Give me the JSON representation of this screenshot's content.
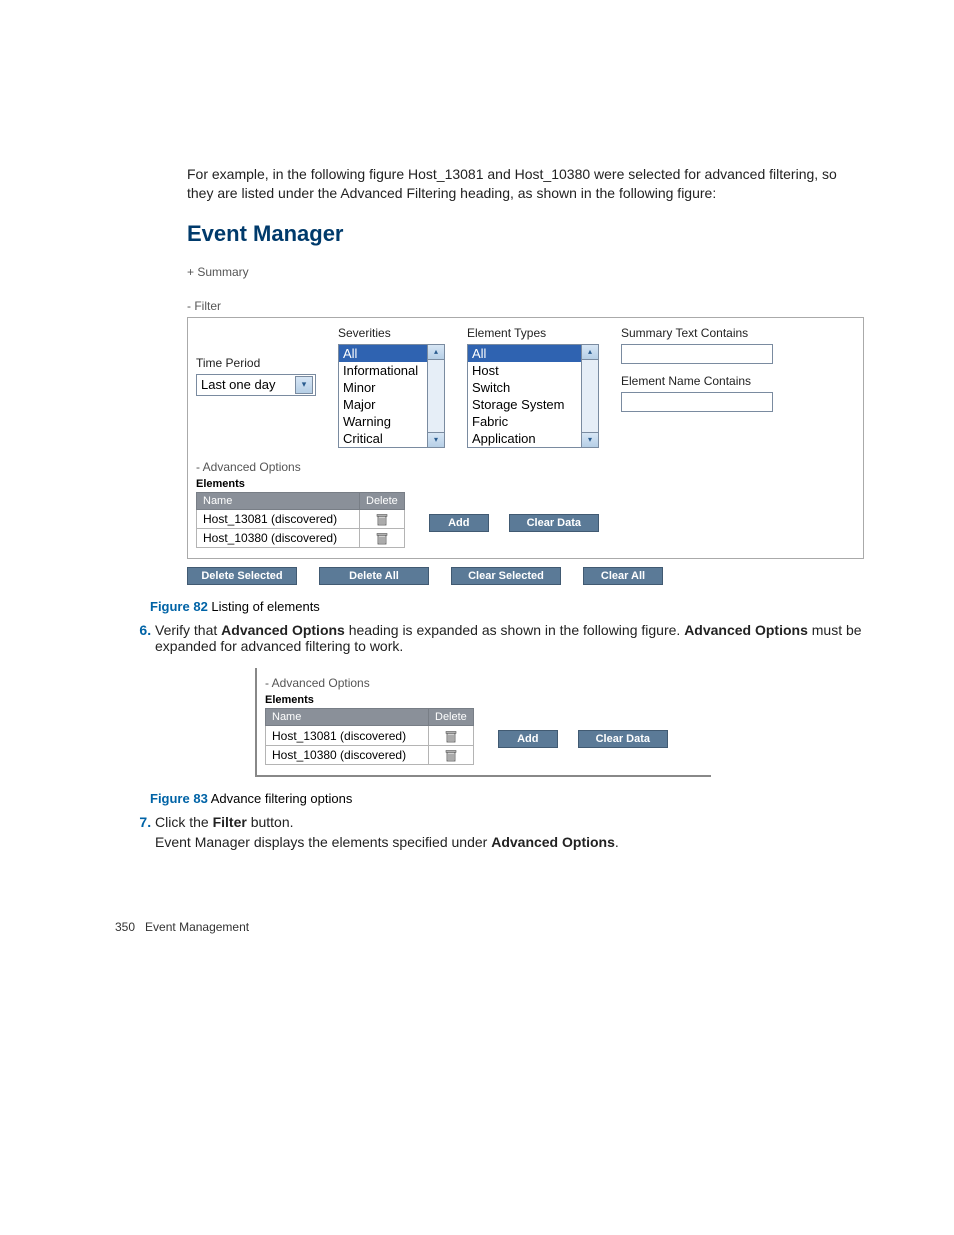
{
  "intro_text": "For example, in the following figure Host_13081 and Host_10380 were selected for advanced filtering, so they are listed under the Advanced Filtering heading, as shown in the following figure:",
  "fig82": {
    "title": "Event Manager",
    "summary_toggle": "+ Summary",
    "filter_toggle": "- Filter",
    "time_period_label": "Time Period",
    "time_period_value": "Last one day",
    "severities_label": "Severities",
    "severities": [
      "All",
      "Informational",
      "Minor",
      "Major",
      "Warning",
      "Critical"
    ],
    "element_types_label": "Element Types",
    "element_types": [
      "All",
      "Host",
      "Switch",
      "Storage System",
      "Fabric",
      "Application"
    ],
    "summary_text_label": "Summary Text Contains",
    "element_name_label": "Element Name Contains",
    "adv_toggle": "- Advanced Options",
    "elements_heading": "Elements",
    "col_name": "Name",
    "col_delete": "Delete",
    "rows": [
      "Host_13081 (discovered)",
      "Host_10380 (discovered)"
    ],
    "add_btn": "Add",
    "clear_data_btn": "Clear Data",
    "bottom_buttons": [
      "Delete Selected",
      "Delete All",
      "Clear Selected",
      "Clear All"
    ]
  },
  "fig82_caption_label": "Figure 82",
  "fig82_caption_text": " Listing of elements",
  "step6_prefix": "Verify that ",
  "step6_bold1": "Advanced Options",
  "step6_mid": " heading is expanded as shown in the following figure. ",
  "step6_bold2": "Advanced Options",
  "step6_suffix": " must be expanded for advanced filtering to work.",
  "fig83": {
    "adv_toggle": "- Advanced Options",
    "elements_heading": "Elements",
    "col_name": "Name",
    "col_delete": "Delete",
    "rows": [
      "Host_13081 (discovered)",
      "Host_10380 (discovered)"
    ],
    "add_btn": "Add",
    "clear_data_btn": "Clear Data"
  },
  "fig83_caption_label": "Figure 83",
  "fig83_caption_text": " Advance filtering options",
  "step7_prefix": "Click the ",
  "step7_bold": "Filter",
  "step7_suffix": " button.",
  "step7_para_prefix": "Event Manager displays the elements specified under ",
  "step7_para_bold": "Advanced Options",
  "step7_para_suffix": ".",
  "footer_page": "350",
  "footer_section": "Event Management"
}
